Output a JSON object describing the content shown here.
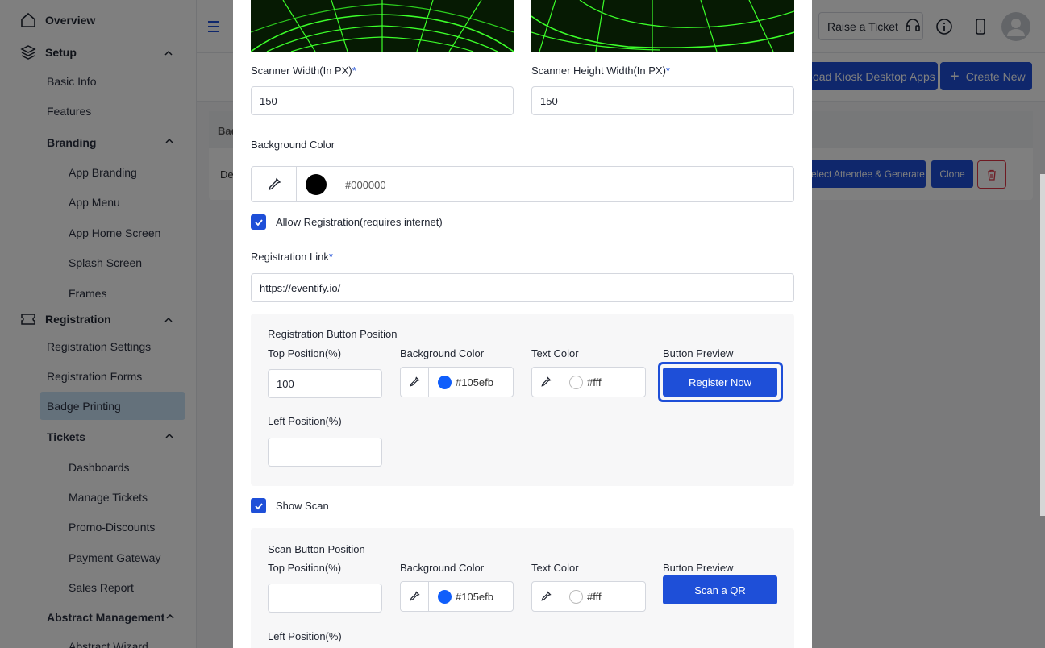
{
  "sidebar": {
    "overview": "Overview",
    "setup": "Setup",
    "setup_items": [
      "Basic Info",
      "Features"
    ],
    "branding": "Branding",
    "branding_items": [
      "App Branding",
      "App Menu",
      "App Home Screen",
      "Splash Screen",
      "Frames"
    ],
    "registration": "Registration",
    "registration_items": [
      "Registration Settings",
      "Registration Forms",
      "Badge Printing"
    ],
    "tickets": "Tickets",
    "tickets_items": [
      "Dashboards",
      "Manage Tickets",
      "Promo-Discounts",
      "Payment Gateway",
      "Sales Report"
    ],
    "abstract": "Abstract Management",
    "abstract_items": [
      "Abstract Wizard"
    ]
  },
  "topbar": {
    "raise_ticket": "Raise a Ticket"
  },
  "actions": {
    "download_kiosk": "oad Kiosk Desktop Apps",
    "create_new": "Create New"
  },
  "table": {
    "header": "Bad",
    "row_text": "De",
    "select_attendee": "elect Attendee & Generate",
    "clone": "Clone"
  },
  "modal": {
    "scanner_width_label": "Scanner Width(In PX)",
    "scanner_width_value": "150",
    "scanner_height_label": "Scanner Height Width(In PX)",
    "scanner_height_value": "150",
    "required_mark": "*",
    "bg_color_label": "Background Color",
    "bg_color_value": "#000000",
    "allow_registration": "Allow Registration(requires internet)",
    "registration_link_label": "Registration Link",
    "registration_link_value": "https://eventify.io/",
    "reg_button": {
      "title": "Registration Button Position",
      "top_label": "Top Position(%)",
      "top_value": "100",
      "bg_label": "Background Color",
      "bg_value": "#105efb",
      "text_label": "Text Color",
      "text_value": "#fff",
      "preview_label": "Button Preview",
      "preview_text": "Register Now",
      "left_label": "Left Position(%)",
      "left_value": ""
    },
    "show_scan": "Show Scan",
    "scan_button": {
      "title": "Scan Button Position",
      "top_label": "Top Position(%)",
      "top_value": "",
      "bg_label": "Background Color",
      "bg_value": "#105efb",
      "text_label": "Text Color",
      "text_value": "#fff",
      "preview_label": "Button Preview",
      "preview_text": "Scan a QR",
      "left_label": "Left Position(%)"
    }
  },
  "colors": {
    "accent": "#1e4fd8",
    "button_bg": "#105efb",
    "grid_green": "#3cff2a"
  }
}
